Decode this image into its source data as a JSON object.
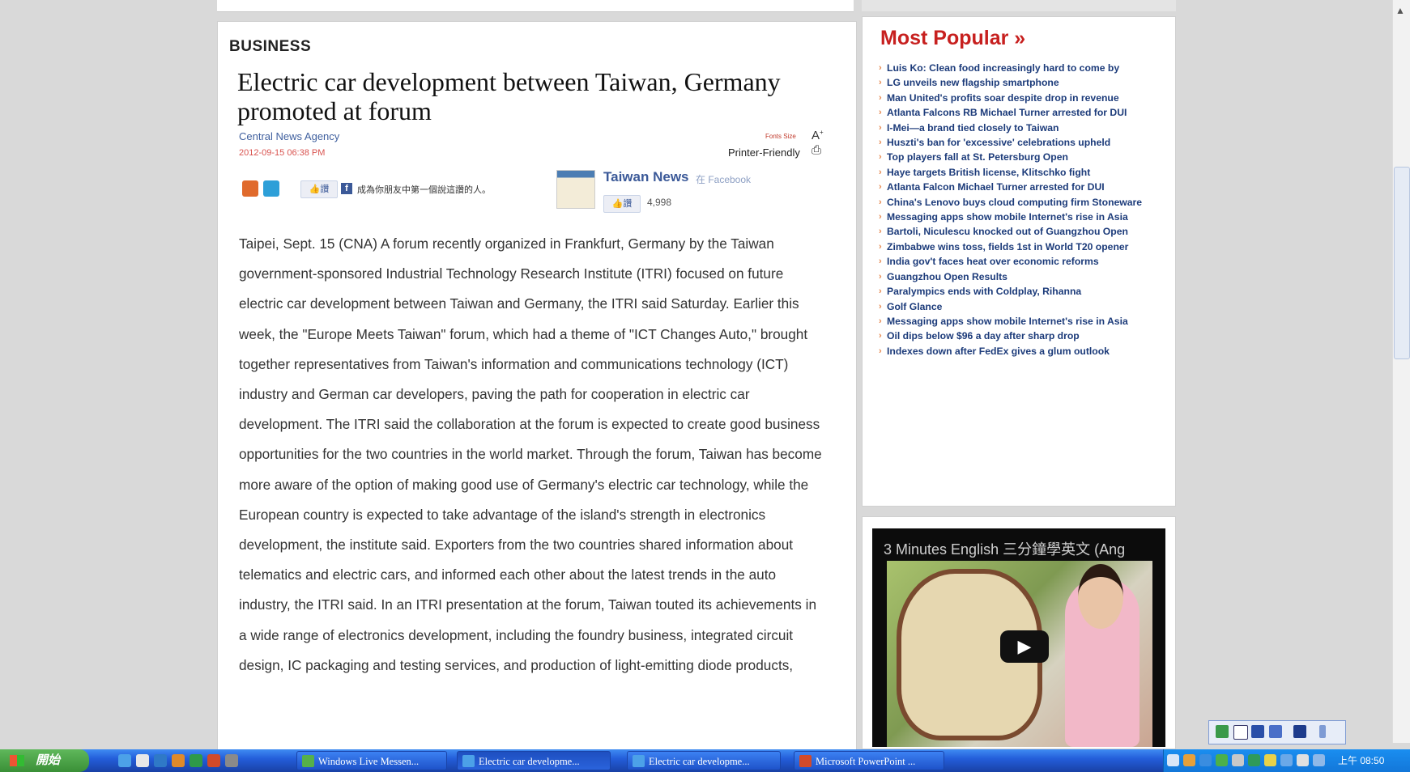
{
  "article": {
    "section": "BUSINESS",
    "headline": "Electric car development between Taiwan, Germany promoted at forum",
    "byline": "Central News Agency",
    "date": "2012-09-15 06:38 PM",
    "font_size_label": "Fonts Size",
    "printer_label": "Printer-Friendly",
    "like_label": "讚",
    "fb_sentence": "成為你朋友中第一個說這讚的人。",
    "page_name": "Taiwan News",
    "page_platform": "在 Facebook",
    "like_count": "4,998",
    "body": "Taipei, Sept. 15 (CNA) A forum recently organized in Frankfurt, Germany by the Taiwan government-sponsored Industrial Technology Research Institute (ITRI) focused on future electric car development between Taiwan and Germany, the ITRI said Saturday. Earlier this week, the \"Europe Meets Taiwan\" forum, which had a theme of \"ICT Changes Auto,\" brought together representatives from Taiwan's information and communications technology (ICT) industry and German car developers, paving the path for cooperation in electric car development. The ITRI said the collaboration at the forum is expected to create good business opportunities for the two countries in the world market. Through the forum, Taiwan has become more aware of the option of making good use of Germany's electric car technology, while the European country is expected to take advantage of the island's strength in electronics development, the institute said. Exporters from the two countries shared information about telematics and electric cars, and informed each other about the latest trends in the auto industry, the ITRI said. In an ITRI presentation at the forum, Taiwan touted its achievements in a wide range of electronics development, including the foundry business, integrated circuit design, IC packaging and testing services, and production of light-emitting diode products,"
  },
  "popular": {
    "title": "Most Popular »",
    "items": [
      "Luis Ko: Clean food increasingly hard to come by",
      "LG unveils new flagship smartphone",
      "Man United's profits soar despite drop in revenue",
      "Atlanta Falcons RB Michael Turner arrested for DUI",
      "I-Mei—a brand tied closely to Taiwan",
      "Huszti's ban for 'excessive' celebrations upheld",
      "Top players fall at St. Petersburg Open",
      "Haye targets British license, Klitschko fight",
      "Atlanta Falcon Michael Turner arrested for DUI",
      "China's Lenovo buys cloud computing firm Stoneware",
      "Messaging apps show mobile Internet's rise in Asia",
      "Bartoli, Niculescu knocked out of Guangzhou Open",
      "Zimbabwe wins toss, fields 1st in World T20 opener",
      "India gov't faces heat over economic reforms",
      "Guangzhou Open Results",
      "Paralympics ends with Coldplay, Rihanna",
      "Golf Glance",
      "Messaging apps show mobile Internet's rise in Asia",
      "Oil dips below $96 a day after sharp drop",
      "Indexes down after FedEx gives a glum outlook"
    ]
  },
  "video": {
    "title": "3 Minutes English 三分鐘學英文 (Ang"
  },
  "taskbar": {
    "start_label": "開始",
    "buttons": [
      "Windows Live Messen...",
      "Electric car developme...",
      "Electric car developme...",
      "Microsoft PowerPoint ..."
    ],
    "clock": "上午 08:50"
  },
  "colors": {
    "popular_title": "#c7201f",
    "popular_link": "#1c3b7a",
    "taskbar": "#245edb",
    "start_button": "#3a8f37"
  }
}
